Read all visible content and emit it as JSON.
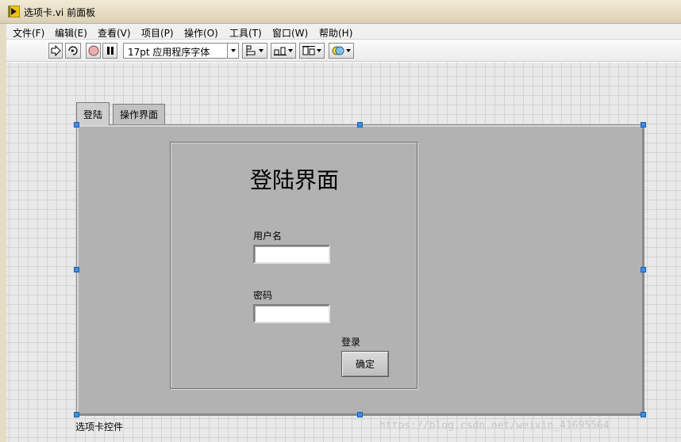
{
  "window": {
    "title": "选项卡.vi 前面板"
  },
  "menu": {
    "items": [
      "文件(F)",
      "编辑(E)",
      "查看(V)",
      "项目(P)",
      "操作(O)",
      "工具(T)",
      "窗口(W)",
      "帮助(H)"
    ]
  },
  "toolbar": {
    "font_label": "17pt 应用程序字体"
  },
  "tabs": {
    "items": [
      "登陆",
      "操作界面"
    ],
    "selected": "登陆"
  },
  "login": {
    "title": "登陆界面",
    "username_label": "用户名",
    "username_value": "",
    "password_label": "密码",
    "password_value": "",
    "login_label": "登录",
    "ok_button": "确定"
  },
  "tab_control_label": "选项卡控件",
  "watermark": "https://blog.csdn.net/weixin_41695564",
  "colors": {
    "panel_bg": "#b2b2b2",
    "grid_bg": "#e9e9e9",
    "handle": "#3a8ee6"
  }
}
